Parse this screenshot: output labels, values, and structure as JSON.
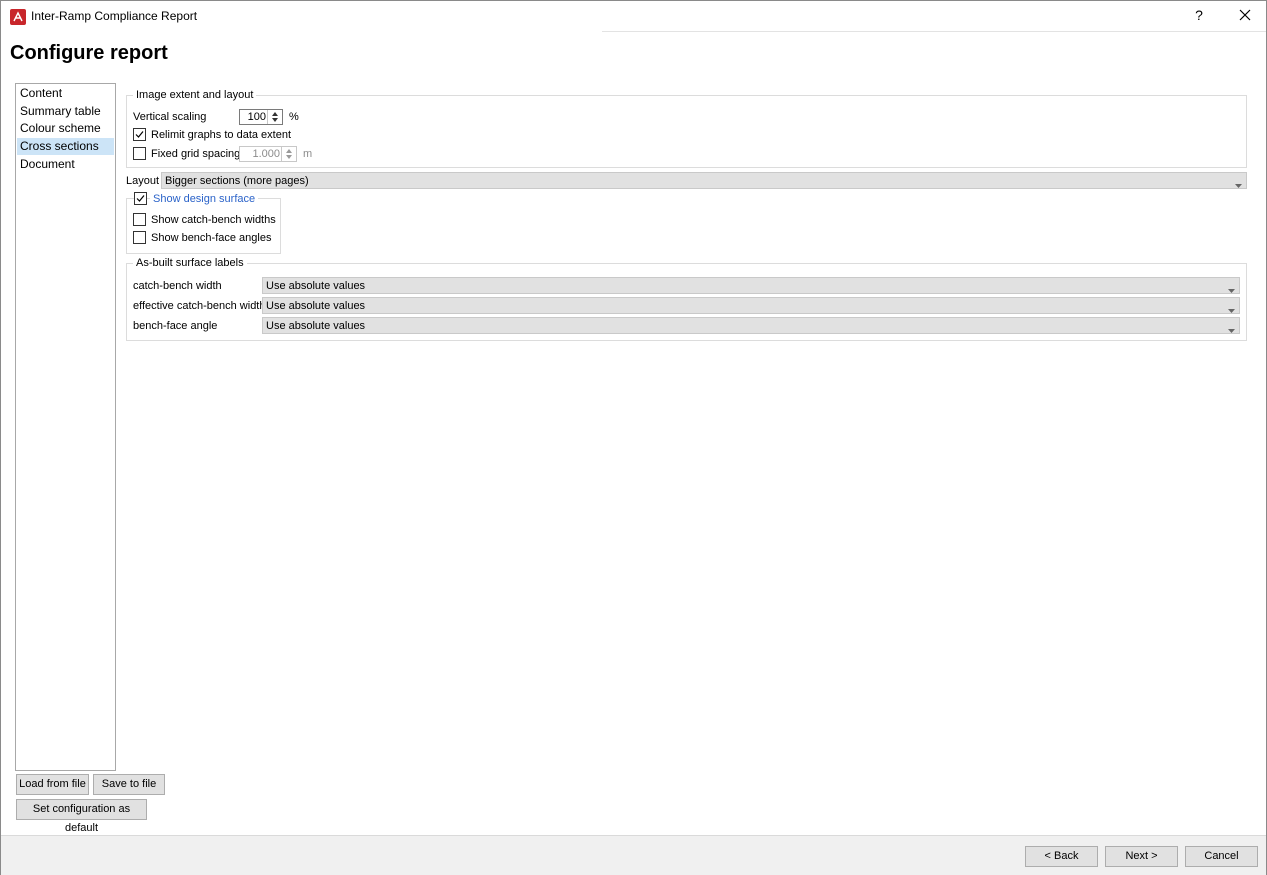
{
  "window": {
    "title": "Inter-Ramp Compliance Report",
    "help_label": "?",
    "close_icon": "close-icon"
  },
  "page_title": "Configure report",
  "nav": {
    "items": [
      {
        "label": "Content",
        "selected": false
      },
      {
        "label": "Summary table",
        "selected": false
      },
      {
        "label": "Colour scheme",
        "selected": false
      },
      {
        "label": "Cross sections",
        "selected": true
      },
      {
        "label": "Document",
        "selected": false
      }
    ]
  },
  "image_extent": {
    "title": "Image extent and layout",
    "vertical_scaling_label": "Vertical scaling",
    "vertical_scaling_value": "100",
    "vertical_scaling_unit": "%",
    "relimit_label": "Relimit graphs to data extent",
    "relimit_checked": true,
    "fixed_grid_label": "Fixed grid spacing",
    "fixed_grid_checked": false,
    "fixed_grid_value": "1.000",
    "fixed_grid_unit": "m"
  },
  "layout": {
    "label": "Layout",
    "value": "Bigger sections (more pages)"
  },
  "design_surface": {
    "show_design_label": "Show design surface",
    "show_design_checked": true,
    "catch_bench_label": "Show catch-bench widths",
    "catch_bench_checked": false,
    "bench_face_label": "Show bench-face angles",
    "bench_face_checked": false
  },
  "as_built": {
    "title": "As-built surface labels",
    "rows": [
      {
        "label": "catch-bench width",
        "value": "Use absolute values"
      },
      {
        "label": "effective catch-bench width",
        "value": "Use absolute values"
      },
      {
        "label": "bench-face angle",
        "value": "Use absolute values"
      }
    ]
  },
  "config_buttons": {
    "load": "Load from file",
    "save": "Save to file",
    "set_default": "Set configuration as default"
  },
  "footer": {
    "back": "< Back",
    "next": "Next >",
    "cancel": "Cancel"
  },
  "colors": {
    "selected_nav": "#cce4f7",
    "accent_blue_text": "#2b63c9",
    "app_icon_red": "#c8262b"
  }
}
